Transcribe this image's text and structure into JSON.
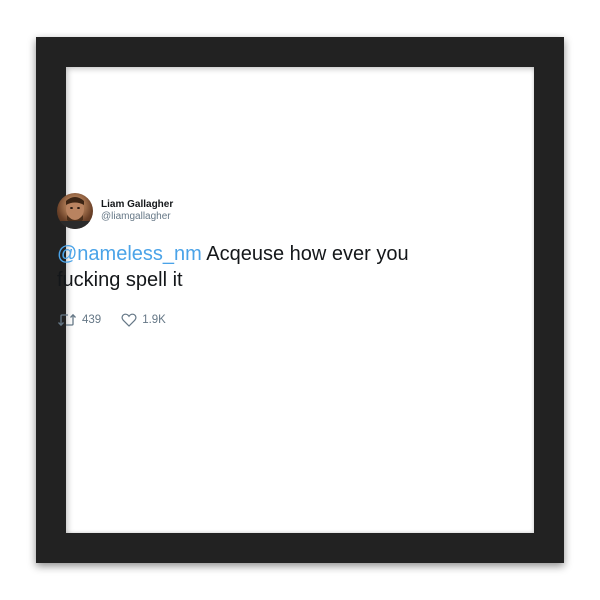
{
  "tweet": {
    "display_name": "Liam Gallagher",
    "handle": "@liamgallagher",
    "mention": "@nameless_nm",
    "text": " Acqeuse how ever you fucking spell it",
    "retweets": "439",
    "likes": "1.9K"
  },
  "icons": {
    "avatar": "profile-photo",
    "retweet": "retweet-icon",
    "like": "heart-icon"
  },
  "colors": {
    "frame": "#222222",
    "mention": "#4aa3e8",
    "text": "#14171a",
    "muted": "#657786"
  }
}
